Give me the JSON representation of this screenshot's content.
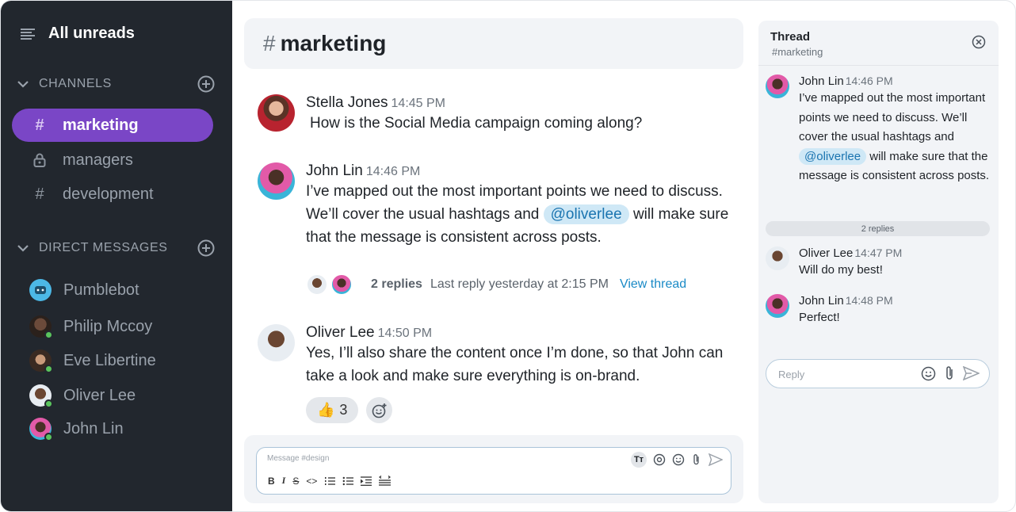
{
  "sidebar": {
    "title": "All unreads",
    "channels_label": "CHANNELS",
    "channels": [
      {
        "name": "marketing",
        "icon": "hash-icon",
        "active": true
      },
      {
        "name": "managers",
        "icon": "lock-icon",
        "active": false
      },
      {
        "name": "development",
        "icon": "hash-icon",
        "active": false
      }
    ],
    "dm_label": "DIRECT MESSAGES",
    "dms": [
      {
        "name": "Pumblebot"
      },
      {
        "name": "Philip Mccoy"
      },
      {
        "name": "Eve Libertine"
      },
      {
        "name": "Oliver Lee"
      },
      {
        "name": "John Lin"
      }
    ]
  },
  "channel": {
    "hash": "#",
    "name": "marketing"
  },
  "messages": [
    {
      "author": "Stella Jones",
      "time": "14:45 PM",
      "text": "How is the Social Media campaign coming along?"
    },
    {
      "author": "John Lin",
      "time": "14:46 PM",
      "text_before": "I’ve mapped out the most important points we need to discuss. We’ll cover the usual hashtags and",
      "mention": "@oliverlee",
      "text_after": "will make sure that the message is consistent across posts."
    },
    {
      "author": "Oliver Lee",
      "time": "14:50 PM",
      "text": "Yes, I’ll also share the content once I’m done, so that John can take a look and make sure everything is on-brand."
    }
  ],
  "reply_summary": {
    "count": "2 replies",
    "last": "Last reply yesterday at 2:15 PM",
    "link": "View thread"
  },
  "reaction": {
    "emoji": "👍",
    "count": "3"
  },
  "composer": {
    "placeholder": "Message #design",
    "format_label": "Tт"
  },
  "thread": {
    "title": "Thread",
    "channel": "#marketing",
    "parent": {
      "author": "John Lin",
      "time": "14:46 PM",
      "text_before": "I’ve mapped out the most important points we need to discuss. We’ll cover the usual hashtags and",
      "mention": "@oliverlee",
      "text_after": "will make sure that the message is consistent across posts."
    },
    "divider": "2 replies",
    "replies": [
      {
        "author": "Oliver Lee",
        "time": "14:47 PM",
        "text": "Will do my best!"
      },
      {
        "author": "John Lin",
        "time": "14:48 PM",
        "text": "Perfect!"
      }
    ],
    "reply_placeholder": "Reply"
  },
  "colors": {
    "accent": "#7a46c6",
    "link": "#1a8ac6",
    "online": "#5ac45d",
    "sidebar_bg": "#22272e"
  }
}
